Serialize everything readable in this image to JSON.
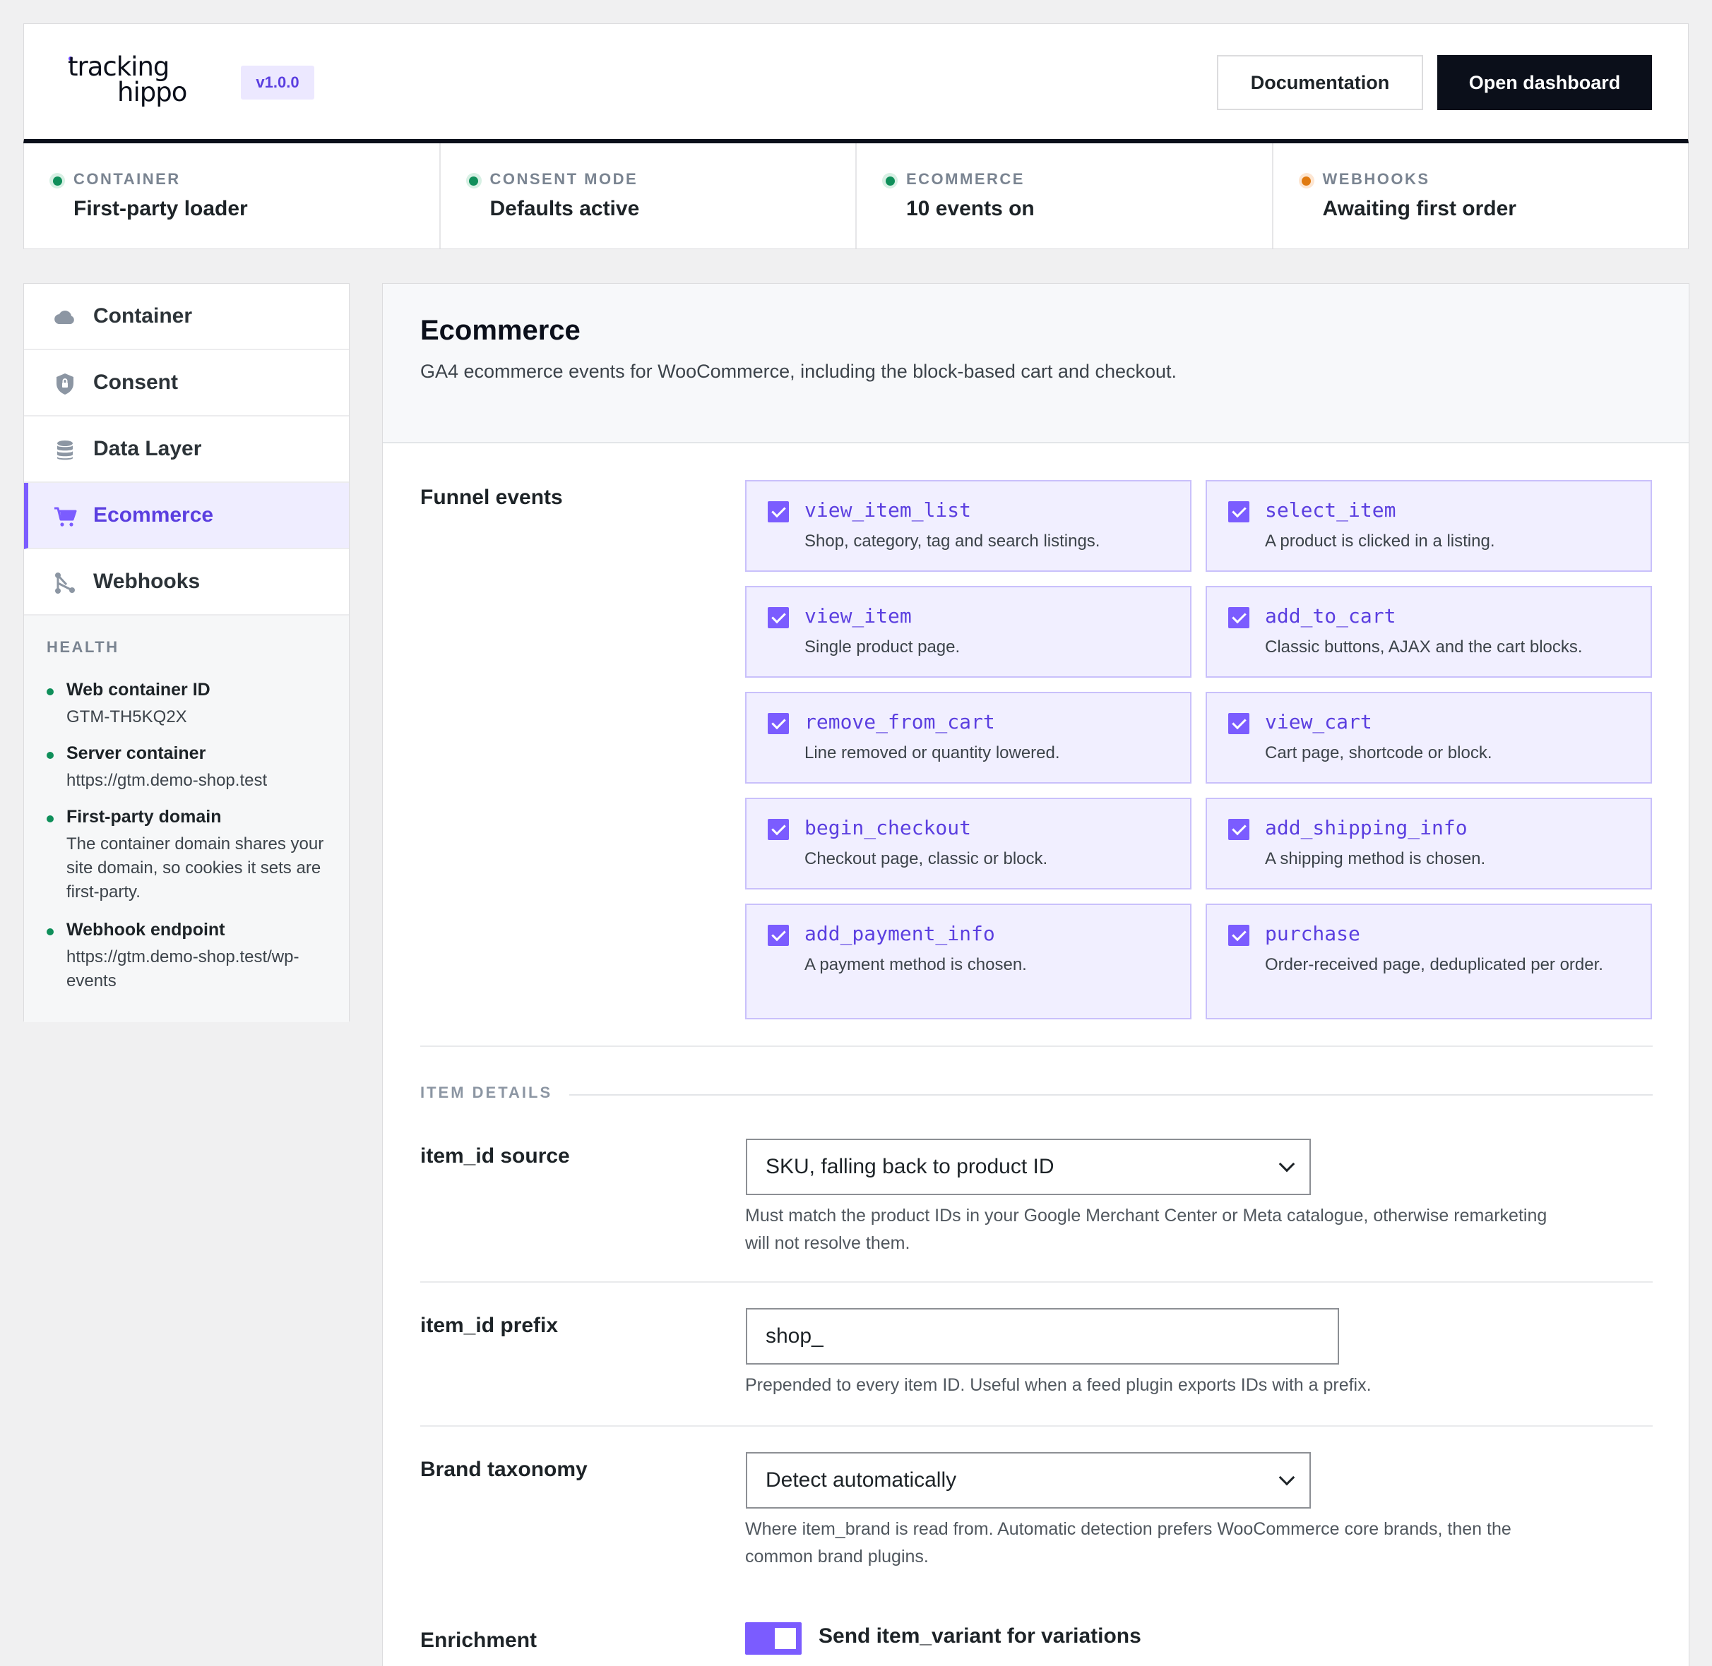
{
  "brand": {
    "logo_line1": "tracking",
    "logo_line2": "hippo",
    "version": "v1.0.0"
  },
  "header": {
    "documentation_label": "Documentation",
    "dashboard_label": "Open dashboard"
  },
  "status": [
    {
      "label": "CONTAINER",
      "value": "First-party loader",
      "state": "green"
    },
    {
      "label": "CONSENT MODE",
      "value": "Defaults active",
      "state": "green"
    },
    {
      "label": "ECOMMERCE",
      "value": "10 events on",
      "state": "green"
    },
    {
      "label": "WEBHOOKS",
      "value": "Awaiting first order",
      "state": "orange"
    }
  ],
  "sidebar": {
    "items": [
      {
        "label": "Container",
        "icon": "cloud-icon"
      },
      {
        "label": "Consent",
        "icon": "shield-icon"
      },
      {
        "label": "Data Layer",
        "icon": "database-icon"
      },
      {
        "label": "Ecommerce",
        "icon": "cart-icon",
        "active": true
      },
      {
        "label": "Webhooks",
        "icon": "webhook-icon"
      }
    ],
    "health_title": "HEALTH",
    "health": [
      {
        "name": "Web container ID",
        "value": "GTM-TH5KQ2X"
      },
      {
        "name": "Server container",
        "value": "https://gtm.demo-shop.test"
      },
      {
        "name": "First-party domain",
        "value": "The container domain shares your site domain, so cookies it sets are first-party."
      },
      {
        "name": "Webhook endpoint",
        "value": "https://gtm.demo-shop.test/wp-events"
      }
    ]
  },
  "main": {
    "title": "Ecommerce",
    "description": "GA4 ecommerce events for WooCommerce, including the block-based cart and checkout.",
    "funnel_label": "Funnel events",
    "events": [
      {
        "name": "view_item_list",
        "desc": "Shop, category, tag and search listings.",
        "checked": true
      },
      {
        "name": "select_item",
        "desc": "A product is clicked in a listing.",
        "checked": true
      },
      {
        "name": "view_item",
        "desc": "Single product page.",
        "checked": true
      },
      {
        "name": "add_to_cart",
        "desc": "Classic buttons, AJAX and the cart blocks.",
        "checked": true
      },
      {
        "name": "remove_from_cart",
        "desc": "Line removed or quantity lowered.",
        "checked": true
      },
      {
        "name": "view_cart",
        "desc": "Cart page, shortcode or block.",
        "checked": true
      },
      {
        "name": "begin_checkout",
        "desc": "Checkout page, classic or block.",
        "checked": true
      },
      {
        "name": "add_shipping_info",
        "desc": "A shipping method is chosen.",
        "checked": true
      },
      {
        "name": "add_payment_info",
        "desc": "A payment method is chosen.",
        "checked": true
      },
      {
        "name": "purchase",
        "desc": "Order-received page, deduplicated per order.",
        "checked": true
      }
    ],
    "item_details_caption": "ITEM DETAILS",
    "item_id_source": {
      "label": "item_id source",
      "value": "SKU, falling back to product ID",
      "help": "Must match the product IDs in your Google Merchant Center or Meta catalogue, otherwise remarketing will not resolve them."
    },
    "item_id_prefix": {
      "label": "item_id prefix",
      "value": "shop_",
      "help": "Prepended to every item ID. Useful when a feed plugin exports IDs with a prefix."
    },
    "brand_taxonomy": {
      "label": "Brand taxonomy",
      "value": "Detect automatically",
      "help": "Where item_brand is read from. Automatic detection prefers WooCommerce core brands, then the common brand plugins."
    },
    "enrichment": {
      "label": "Enrichment",
      "toggle_label": "Send item_variant for variations",
      "enabled": true
    }
  },
  "colors": {
    "accent": "#7b5cff",
    "dark": "#0b0f1a",
    "ok": "#0f8f5a",
    "warn": "#e07a10"
  }
}
